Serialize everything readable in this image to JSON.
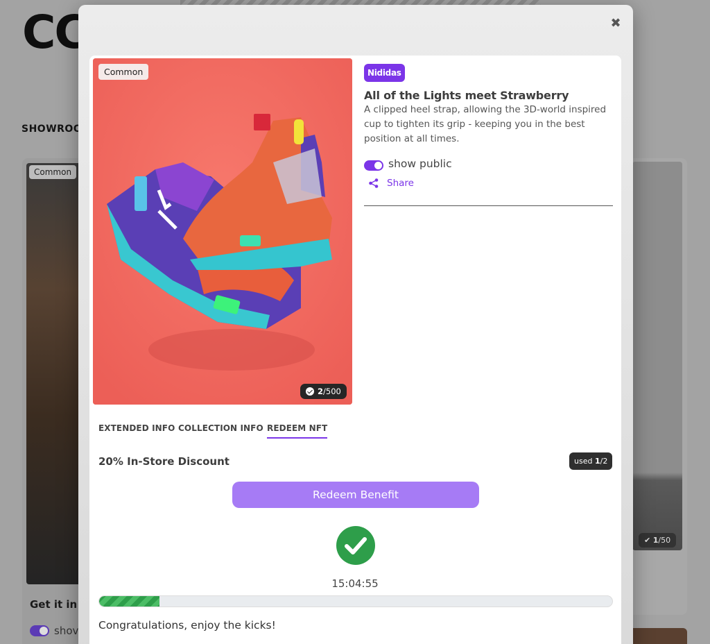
{
  "background": {
    "title_fragment": "CC",
    "showroom_label": "SHOWROO",
    "left_card": {
      "rarity": "Common",
      "title": "Get it in!",
      "toggle_label": "shov"
    },
    "right_card": {
      "edition_current": "1",
      "edition_total": "/50"
    }
  },
  "modal": {
    "close_icon": "close-icon",
    "rarity": "Common",
    "edition": {
      "current": "2",
      "total": "/500"
    },
    "brand": "Nididas",
    "title": "All of the Lights meet Strawberry",
    "description": "A clipped heel strap, allowing the 3D-world inspired cup to tighten its grip - keeping you in the best position at all times.",
    "show_public": {
      "label": "show public",
      "enabled": true
    },
    "share_label": "Share",
    "tabs": [
      {
        "label": "EXTENDED INFO",
        "active": false
      },
      {
        "label": "COLLECTION INFO",
        "active": false
      },
      {
        "label": "REDEEM NFT",
        "active": true
      }
    ],
    "redeem": {
      "benefit_title": "20% In-Store Discount",
      "used_prefix": "used ",
      "used_count": "1",
      "used_total": "/2",
      "button_label": "Redeem Benefit",
      "timer": "15:04:55",
      "progress_fraction": 0.117,
      "message": "Congratulations, enjoy the kicks!"
    }
  },
  "colors": {
    "accent": "#7b35e8",
    "button": "#a67bf5",
    "success": "#2e9e4a",
    "image_background": "#f26a60"
  }
}
